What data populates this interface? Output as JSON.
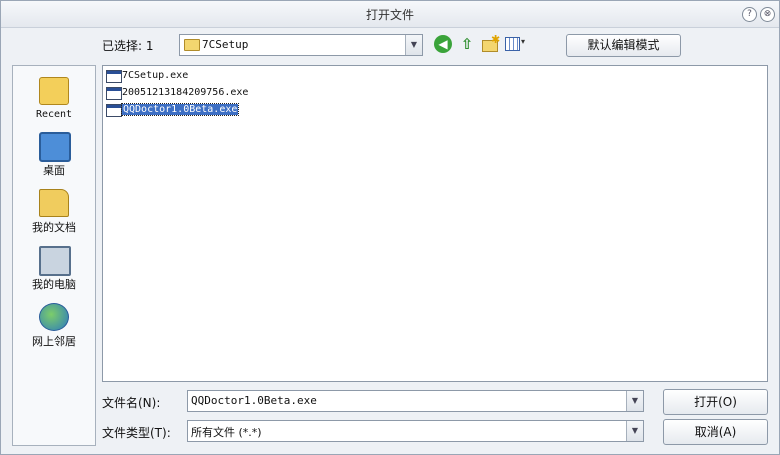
{
  "window": {
    "title": "打开文件",
    "help_glyph": "?",
    "close_glyph": "⊗"
  },
  "toolbar": {
    "selected_label": "已选择: 1",
    "lookin_value": "7CSetup",
    "dropdown_glyph": "▼",
    "back_glyph": "◀",
    "up_glyph": "⇧",
    "view_caret": "▾",
    "default_edit_mode_label": "默认编辑模式",
    "icons": [
      "folder-icon",
      "back-icon",
      "up-folder-icon",
      "new-folder-icon",
      "view-menu-icon"
    ]
  },
  "places": [
    {
      "label": "Recent",
      "icon": "recent-folder-icon"
    },
    {
      "label": "桌面",
      "icon": "desktop-icon"
    },
    {
      "label": "我的文档",
      "icon": "my-documents-icon"
    },
    {
      "label": "我的电脑",
      "icon": "my-computer-icon"
    },
    {
      "label": "网上邻居",
      "icon": "network-icon"
    }
  ],
  "files": [
    {
      "name": "7CSetup.exe",
      "selected": false
    },
    {
      "name": "20051213184209756.exe",
      "selected": false
    },
    {
      "name": "QQDoctor1.0Beta.exe",
      "selected": true
    }
  ],
  "bottom": {
    "filename_label": "文件名(N):",
    "filename_value": "QQDoctor1.0Beta.exe",
    "filetype_label": "文件类型(T):",
    "filetype_value": "所有文件 (*.*)",
    "open_label": "打开(O)",
    "cancel_label": "取消(A)"
  },
  "colors": {
    "selection": "#3d6fc4",
    "window_bg": "#eef1f5"
  }
}
